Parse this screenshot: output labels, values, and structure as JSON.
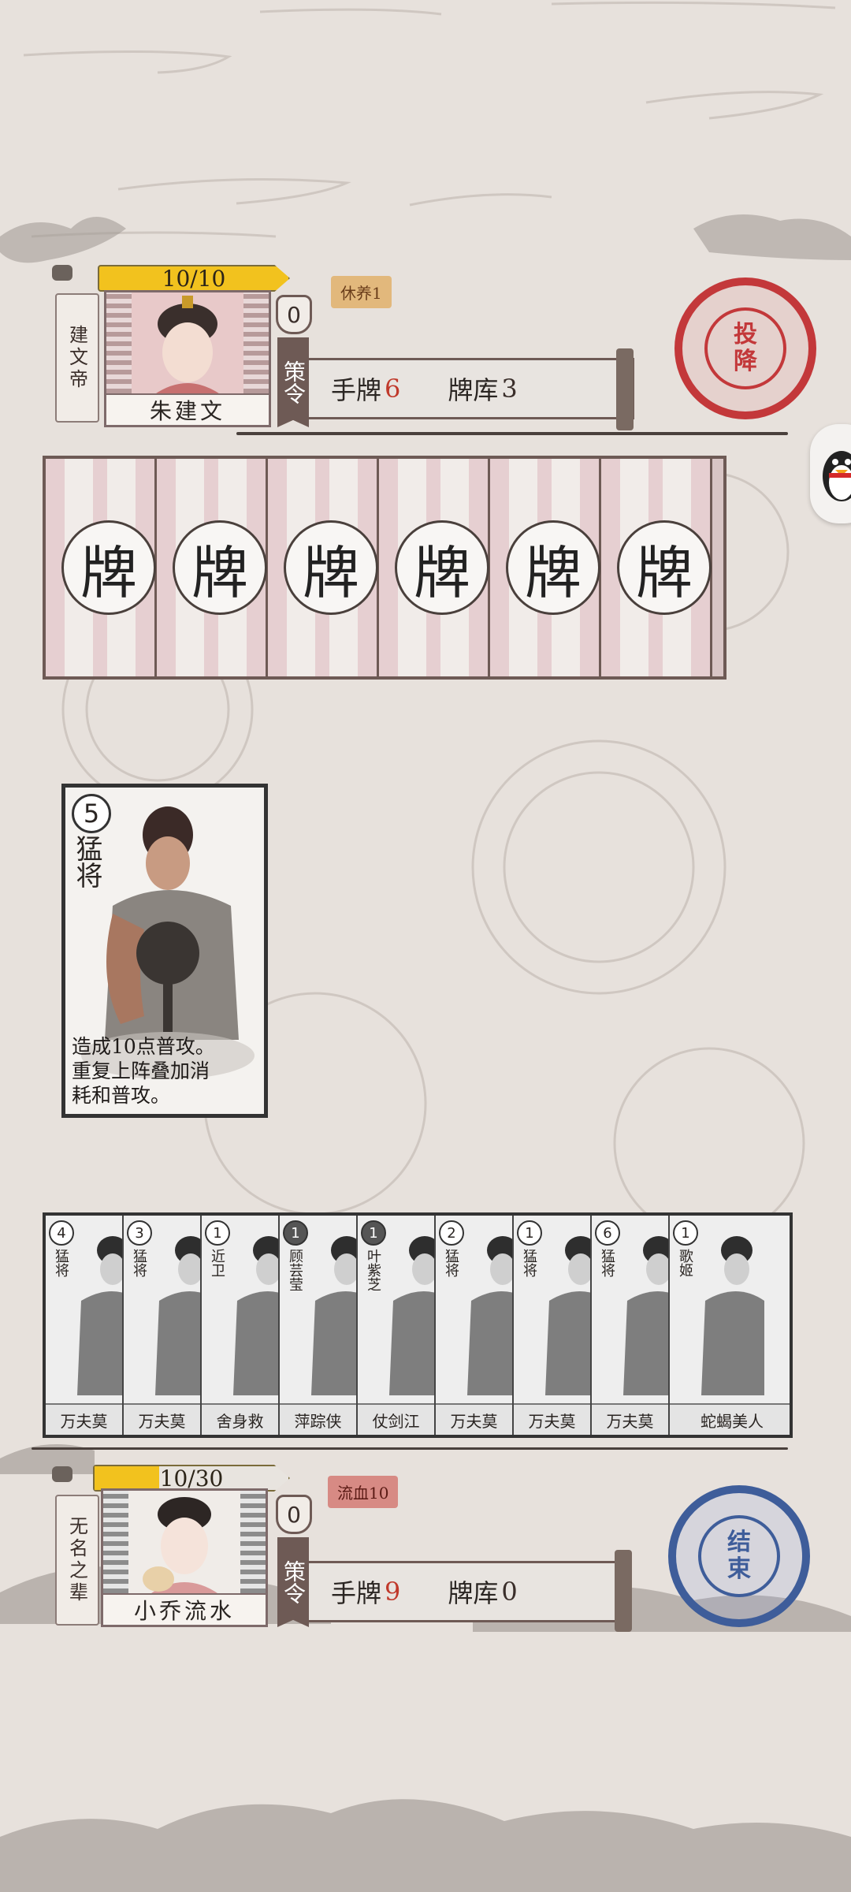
{
  "opponent": {
    "hp": "10/10",
    "hp_fraction": 1.0,
    "title": "建文帝",
    "name": "朱建文",
    "shield": "0",
    "strategy_label": "策令",
    "hand_label": "手牌",
    "hand_count": "6",
    "deck_label": "牌库",
    "deck_count": "3",
    "status": "休养1",
    "surrender_label": [
      "投",
      "降"
    ]
  },
  "card_back": {
    "glyph": "牌",
    "count": 6
  },
  "played_card": {
    "cost": "5",
    "name": "猛将",
    "desc_lines": [
      "造成10点普攻。",
      "重复上阵叠加消",
      "耗和普攻。"
    ]
  },
  "hand": [
    {
      "cost": "4",
      "name": "猛将",
      "skill": "万夫莫",
      "dark": false
    },
    {
      "cost": "3",
      "name": "猛将",
      "skill": "万夫莫",
      "dark": false
    },
    {
      "cost": "1",
      "name": "近卫",
      "skill": "舍身救",
      "dark": false
    },
    {
      "cost": "1",
      "name": "顾芸莹",
      "skill": "萍踪侠",
      "dark": true
    },
    {
      "cost": "1",
      "name": "叶紫芝",
      "skill": "仗剑江",
      "dark": true
    },
    {
      "cost": "2",
      "name": "猛将",
      "skill": "万夫莫",
      "dark": false
    },
    {
      "cost": "1",
      "name": "猛将",
      "skill": "万夫莫",
      "dark": false
    },
    {
      "cost": "6",
      "name": "猛将",
      "skill": "万夫莫",
      "dark": false
    },
    {
      "cost": "1",
      "name": "歌姬",
      "skill": "蛇蝎美人",
      "dark": false
    }
  ],
  "player": {
    "hp": "10/30",
    "hp_fraction": 0.333,
    "title": "无名之辈",
    "name": "小乔流水",
    "shield": "0",
    "strategy_label": "策令",
    "hand_label": "手牌",
    "hand_count": "9",
    "deck_label": "牌库",
    "deck_count": "0",
    "status": "流血10",
    "end_turn_label": [
      "结",
      "束"
    ]
  },
  "colors": {
    "background": "#e7e1dc",
    "hp_yellow": "#f2c21e",
    "surrender_red": "#c3383a",
    "end_blue": "#3e5d9a",
    "count_red": "#c0392b"
  }
}
